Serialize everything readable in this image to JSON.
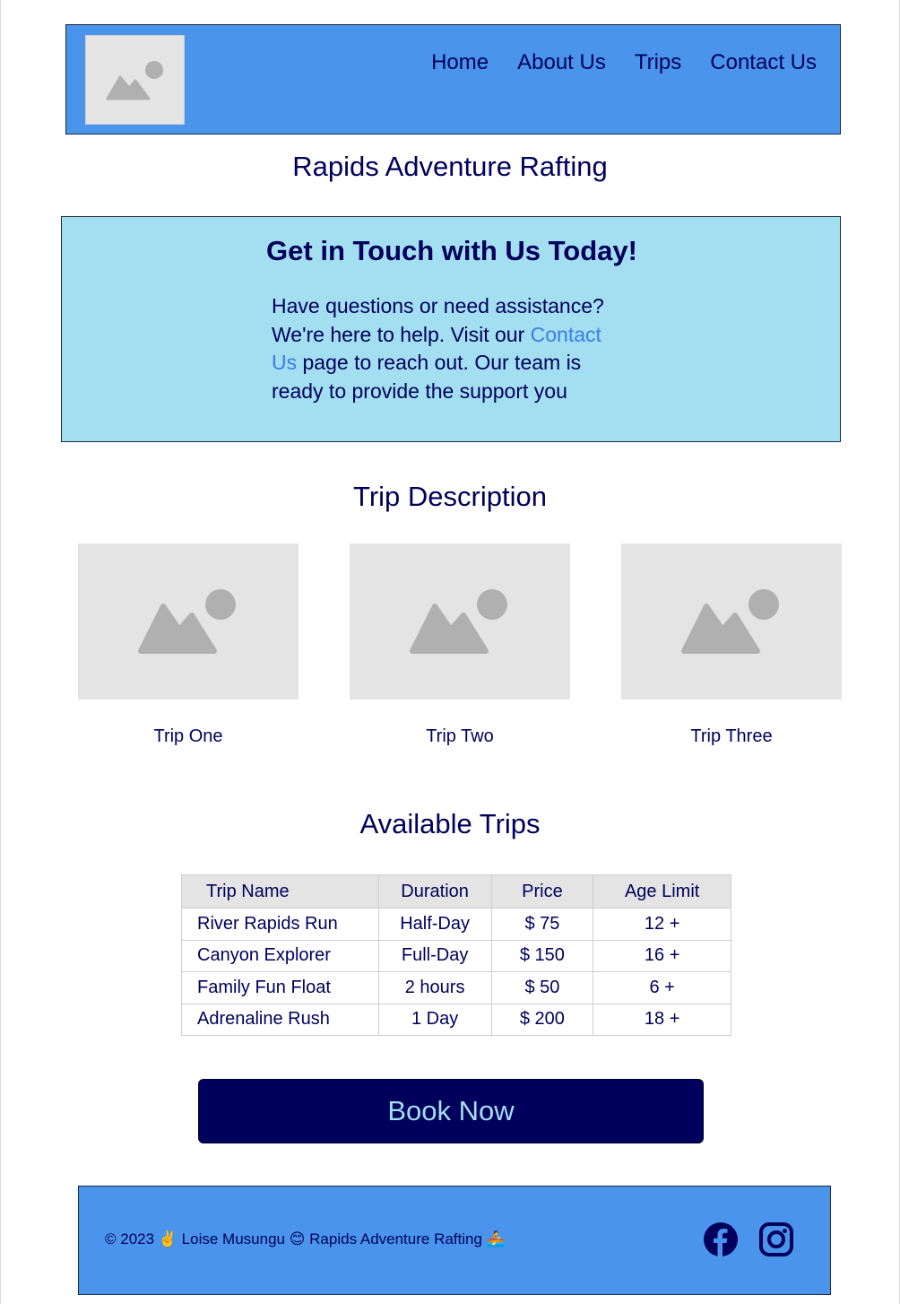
{
  "header": {
    "logo_icon": "image-placeholder-icon",
    "nav": [
      "Home",
      "About Us",
      "Trips",
      "Contact Us"
    ]
  },
  "site_title": "Rapids Adventure Rafting",
  "contact": {
    "heading": "Get in Touch with Us Today!",
    "text_before": "Have questions or need assistance? We're here to help. Visit our ",
    "link": "Contact Us",
    "text_after": " page to reach out. Our team is ready to provide the support you"
  },
  "trip_description": {
    "title": "Trip Description",
    "cards": [
      "Trip One",
      "Trip Two",
      "Trip Three"
    ]
  },
  "available_trips": {
    "title": "Available Trips",
    "columns": [
      "Trip Name",
      "Duration",
      "Price",
      "Age Limit"
    ],
    "rows": [
      [
        "River Rapids Run",
        "Half-Day",
        "$ 75",
        "12 +"
      ],
      [
        "Canyon Explorer",
        "Full-Day",
        "$ 150",
        "16 +"
      ],
      [
        "Family Fun Float",
        "2 hours",
        "$ 50",
        "6 +"
      ],
      [
        "Adrenaline Rush",
        "1 Day",
        "$ 200",
        "18 +"
      ]
    ]
  },
  "book_button": "Book Now",
  "footer": {
    "text": "© 2023 ✌️ Loise Musungu 😊 Rapids Adventure Rafting 🚣",
    "social_icons": [
      "facebook-icon",
      "instagram-icon"
    ]
  },
  "colors": {
    "header_bg": "#4a94ec",
    "contact_bg": "#a3dff0",
    "text": "#00005c",
    "link": "#3a7de8",
    "button_bg": "#00005c",
    "button_text": "#a3dff0"
  }
}
